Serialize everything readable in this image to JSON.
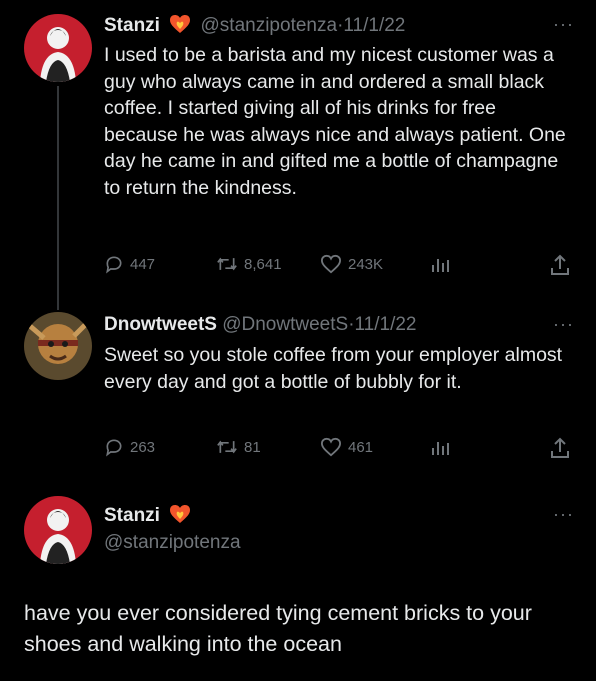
{
  "tweets": [
    {
      "name": "Stanzi",
      "handle": "@stanzipotenza",
      "date": "11/1/22",
      "text": "I used to be a barista and my nicest customer was a guy who always came in and ordered a small black coffee. I started giving all of his drinks for free because he was always nice and always patient. One day he came in and gifted me a bottle of champagne to return the kindness.",
      "replies": "447",
      "retweets": "8,641",
      "likes": "243K"
    },
    {
      "name": "DnowtweetS",
      "handle": "@DnowtweetS",
      "date": "11/1/22",
      "text": "Sweet so you stole coffee from your employer almost every day and got a bottle of bubbly for it.",
      "replies": "263",
      "retweets": "81",
      "likes": "461"
    }
  ],
  "focused": {
    "name": "Stanzi",
    "handle": "@stanzipotenza",
    "text": "have you ever considered tying cement bricks to your shoes and walking into the ocean"
  },
  "separator": "·",
  "more_label": "···",
  "colors": {
    "background": "#000000",
    "text": "#e7e9ea",
    "muted": "#71767b",
    "badge": "#f2552c"
  }
}
